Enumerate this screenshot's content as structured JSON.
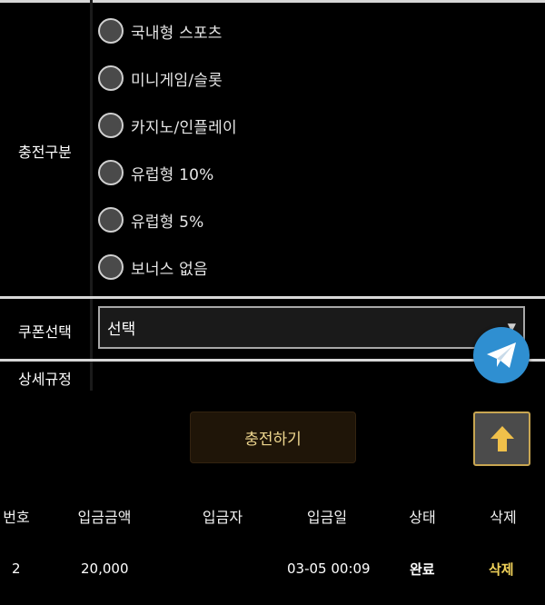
{
  "form": {
    "charge_type_label": "충전구분",
    "options": [
      {
        "label": "국내형 스포츠"
      },
      {
        "label": "미니게임/슬롯"
      },
      {
        "label": "카지노/인플레이"
      },
      {
        "label": "유럽형 10%"
      },
      {
        "label": "유럽형 5%"
      },
      {
        "label": "보너스 없음"
      }
    ],
    "coupon_label": "쿠폰선택",
    "coupon_value": "선택",
    "detail_label": "상세규정"
  },
  "actions": {
    "charge_label": "충전하기"
  },
  "table": {
    "headers": [
      "번호",
      "입금금액",
      "입금자",
      "입금일",
      "상태",
      "삭제"
    ],
    "rows": [
      {
        "no": "2",
        "amount": "20,000",
        "depositor": "",
        "date": "03-05 00:09",
        "status": "완료",
        "delete": "삭제"
      }
    ]
  },
  "colors": {
    "background": "#000000",
    "accent_gold": "#f1d25a",
    "telegram_blue": "#2f8fd1"
  },
  "icons": [
    "telegram-icon",
    "arrow-up-icon",
    "chevron-down-icon"
  ]
}
